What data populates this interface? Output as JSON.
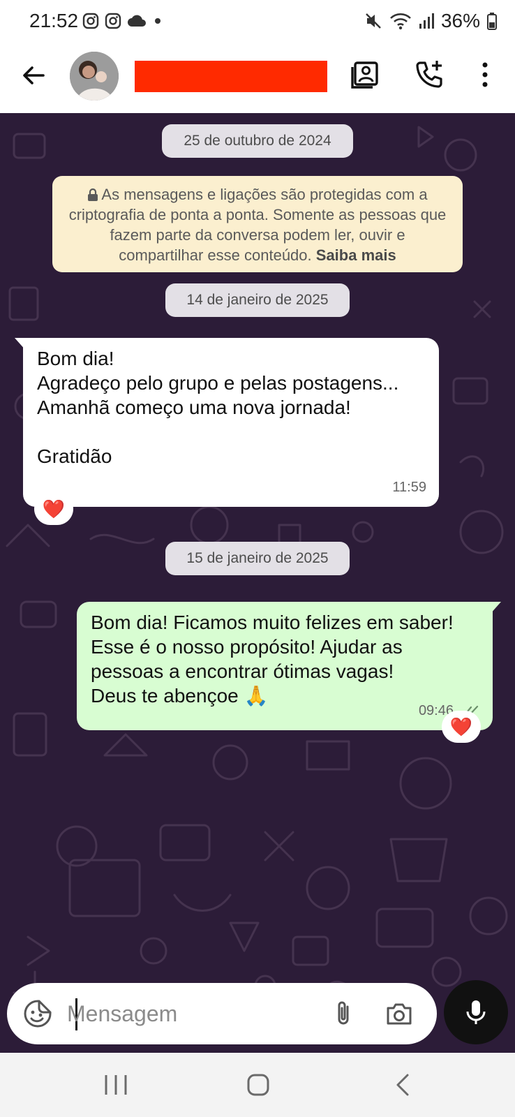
{
  "status_bar": {
    "time": "21:52",
    "left_icons": [
      "instagram-icon",
      "instagram-icon",
      "cloud-icon",
      "dot-icon"
    ],
    "battery": "36%",
    "right_icons": [
      "mute-icon",
      "wifi-icon",
      "signal-icon",
      "battery-icon"
    ]
  },
  "header": {
    "contact_name": "",
    "icons": [
      "back-arrow-icon",
      "contact-card-icon",
      "add-call-icon",
      "more-vert-icon"
    ]
  },
  "colors": {
    "chat_bg": "#2c1c38",
    "incoming_bubble": "#ffffff",
    "outgoing_bubble": "#d8fdd2",
    "notice_bg": "#fbefcf",
    "redaction": "#ff2a00",
    "read_ticks": "#6b8f6b"
  },
  "conversation": {
    "date1": "25 de outubro de 2024",
    "encryption_notice": "As mensagens e ligações são protegidas com a criptografia de ponta a ponta. Somente as pessoas que fazem parte da conversa podem ler, ouvir e compartilhar esse conteúdo.",
    "encryption_link": "Saiba mais",
    "date2": "14 de janeiro de 2025",
    "message1": {
      "text": "Bom dia!\nAgradeço pelo grupo e pelas postagens...\nAmanhã começo uma nova jornada!\n\nGratidão",
      "time": "11:59",
      "reaction": "❤️"
    },
    "date3": "15 de janeiro de 2025",
    "message2": {
      "text": "Bom dia! Ficamos muito felizes em saber! Esse é o nosso propósito! Ajudar as pessoas a encontrar ótimas vagas!\nDeus te abençoe 🙏",
      "time": "09:46",
      "status": "read-ticks-icon",
      "reaction": "❤️"
    }
  },
  "input": {
    "placeholder": "Mensagem",
    "icons": [
      "sticker-icon",
      "attach-icon",
      "camera-icon",
      "mic-icon"
    ]
  },
  "nav": {
    "icons": [
      "recent-apps-icon",
      "home-icon",
      "back-icon"
    ]
  }
}
